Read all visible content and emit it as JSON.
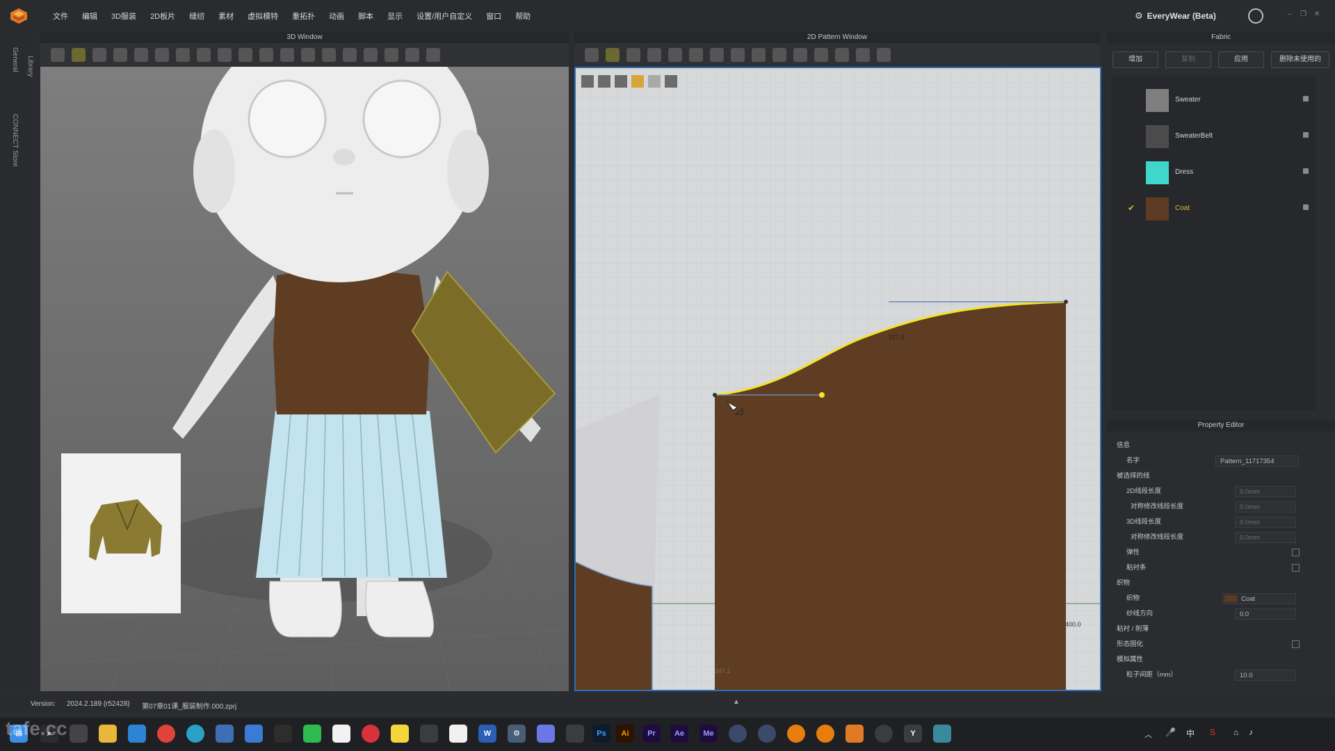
{
  "menu": {
    "items": [
      "文件",
      "编辑",
      "3D服装",
      "2D板片",
      "缝纫",
      "素材",
      "虚拟模特",
      "重拓扑",
      "动画",
      "脚本",
      "显示",
      "设置/用户自定义",
      "窗口",
      "帮助"
    ],
    "everywear_label": "EveryWear (Beta)"
  },
  "left_strip": {
    "tabs": [
      "General",
      "Library",
      "CONNECT Store"
    ]
  },
  "window3d": {
    "title": "3D Window"
  },
  "window2d": {
    "title": "2D Pattern Window",
    "dim_top": "227.6",
    "dim_right": "400.0",
    "dim_bottom": "347.1"
  },
  "fabric": {
    "title": "Fabric",
    "buttons": [
      "增加",
      "复制",
      "应用",
      "删除未使用的"
    ],
    "items": [
      {
        "name": "Sweater",
        "color": "#7f7f7f",
        "checked": false
      },
      {
        "name": "SweaterBelt",
        "color": "#4b4b4b",
        "checked": false
      },
      {
        "name": "Dress",
        "color": "#3fd7cc",
        "checked": false
      },
      {
        "name": "Coat",
        "color": "#5c3b22",
        "checked": true
      }
    ]
  },
  "property_editor": {
    "title": "Property Editor",
    "section_info": "信息",
    "name_label": "名字",
    "name_value": "Pattern_11717354",
    "section_selected_line": "被选择的线",
    "line2d_label": "2D线段长度",
    "line2d_value": "0.0mm",
    "sym2d_label": "对称修改线段长度",
    "sym2d_value": "0.0mm",
    "line3d_label": "3D线段长度",
    "line3d_value": "0.0mm",
    "sym3d_label": "对称修改线段长度",
    "sym3d_value": "0.0mm",
    "elastic_label": "弹性",
    "tape_label": "粘衬条",
    "section_fabric": "织物",
    "fabric_label": "织物",
    "fabric_value": "Coat",
    "grain_label": "纱线方向",
    "grain_value": "0.0",
    "section_fuse": "粘衬 / 削薄",
    "shape_solidify": "形态固化",
    "section_sim": "模拟属性",
    "particle_label": "粒子间距（mm）",
    "particle_value": "10.0"
  },
  "status": {
    "version_label": "Version:",
    "version_value": "2024.2.189 (r52428)",
    "file": "第07章01课_服装制作.000.zprj"
  },
  "colors": {
    "coat_brown": "#5e3d22",
    "selected_panel": "#7b6d27",
    "curve_yellow": "#f2e52a",
    "skirt_blue": "#bfe0ec",
    "accent_orange": "#d89c3a"
  },
  "taskbar": {
    "apps": [
      "windows",
      "search",
      "task-view",
      "file-explorer",
      "store",
      "chrome",
      "edge",
      "app-a",
      "app-b",
      "app-c",
      "wechat",
      "qq",
      "netease-music",
      "sticky-notes",
      "app-d",
      "app-e",
      "word",
      "settings",
      "app-f",
      "app-g",
      "photoshop",
      "illustrator",
      "premiere",
      "after-effects",
      "media-encoder",
      "app-h",
      "app-i",
      "blender",
      "app-j",
      "clo3d",
      "app-k",
      "app-l",
      "calculator"
    ],
    "ps": "Ps",
    "ai": "Ai",
    "pr": "Pr",
    "ae": "Ae",
    "me": "Me",
    "w": "W",
    "y": "Y"
  },
  "watermark": "tafe.cc"
}
